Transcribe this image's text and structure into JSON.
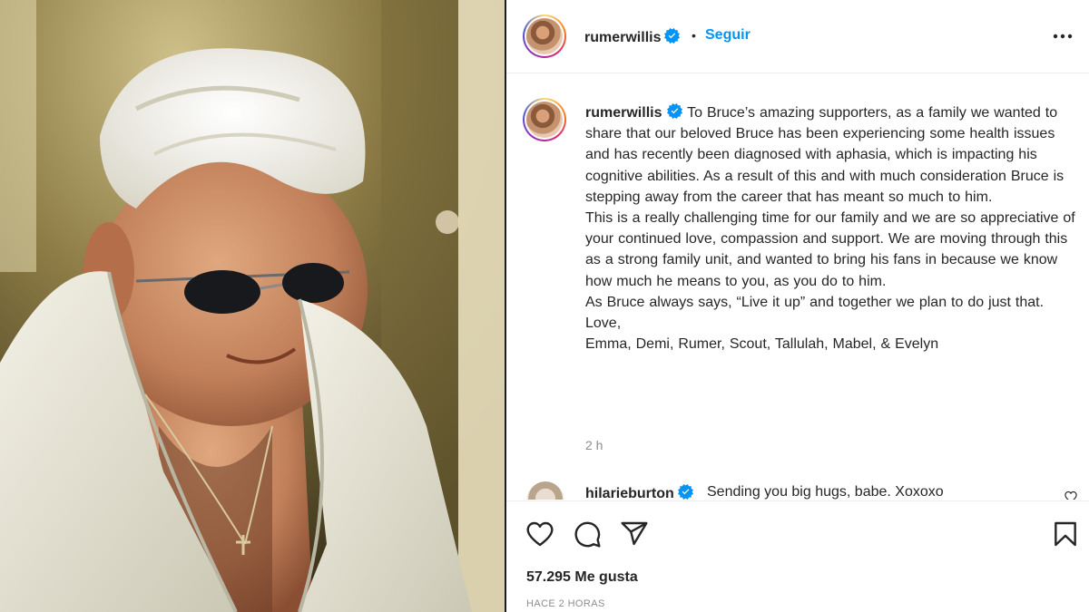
{
  "post": {
    "username": "rumerwillis",
    "verified": true,
    "separator": "•",
    "follow_label": "Seguir",
    "more_icon": "more-options-icon",
    "caption_paragraphs": [
      "To Bruce’s amazing supporters, as a family we wanted to share that our beloved Bruce has been experiencing some health issues and has recently been diagnosed with aphasia, which is impacting his cognitive abilities. As a result of this and with much consideration Bruce is stepping away from the career that has meant so much to him.",
      "This is a really challenging time for our family and we are so appreciative of your continued love, compassion and support. We are moving through this as a strong family unit, and wanted to bring his fans in because we know how much he means to you, as you do to him.",
      "As Bruce always says, “Live it up” and together we plan to do just that.",
      "Love,",
      "Emma, Demi, Rumer, Scout, Tallulah, Mabel, & Evelyn"
    ],
    "caption_time": "2 h"
  },
  "comment": {
    "username": "hilarieburton",
    "verified": true,
    "text": "Sending you big hugs, babe. Xoxoxo"
  },
  "actions": {
    "like_icon": "heart-icon",
    "comment_icon": "comment-bubble-icon",
    "share_icon": "paper-plane-icon",
    "save_icon": "bookmark-icon",
    "likes_text": "57.295 Me gusta",
    "posted_time": "HACE 2 HORAS"
  },
  "colors": {
    "accent": "#0095f6",
    "text": "#262626",
    "muted": "#8e8e8e",
    "verified_badge": "#0095f6"
  }
}
